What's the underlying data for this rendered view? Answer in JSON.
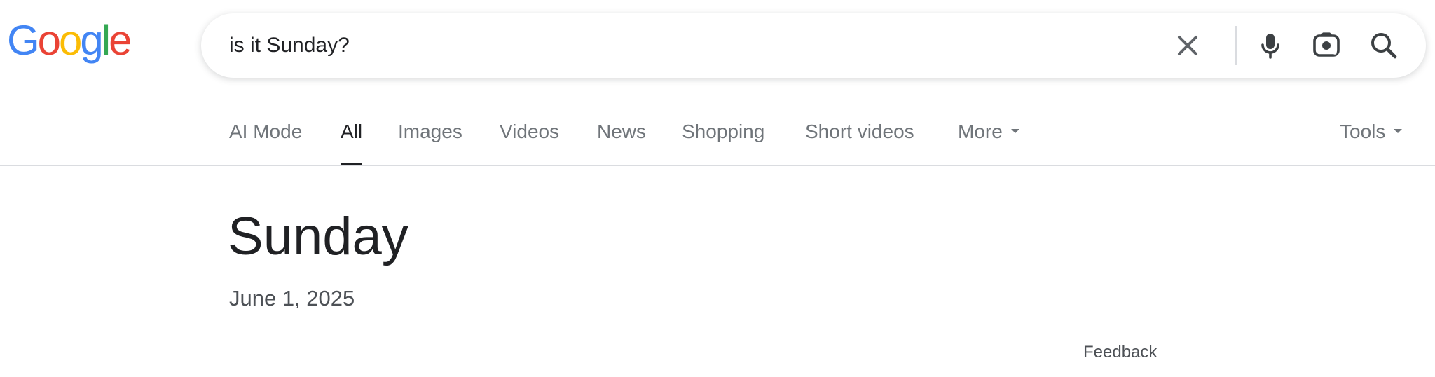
{
  "logo": {
    "letters": [
      {
        "char": "G",
        "color": "#4285F4"
      },
      {
        "char": "o",
        "color": "#EA4335"
      },
      {
        "char": "o",
        "color": "#FBBC05"
      },
      {
        "char": "g",
        "color": "#4285F4"
      },
      {
        "char": "l",
        "color": "#34A853"
      },
      {
        "char": "e",
        "color": "#EA4335"
      }
    ]
  },
  "search": {
    "value": "is it Sunday?",
    "icons": [
      "close-icon",
      "microphone-icon",
      "camera-lens-icon",
      "search-icon"
    ]
  },
  "tabs": [
    {
      "label": "AI Mode",
      "active": false
    },
    {
      "label": "All",
      "active": true
    },
    {
      "label": "Images",
      "active": false
    },
    {
      "label": "Videos",
      "active": false
    },
    {
      "label": "News",
      "active": false
    },
    {
      "label": "Shopping",
      "active": false
    },
    {
      "label": "Short videos",
      "active": false
    },
    {
      "label": "More",
      "active": false,
      "dropdown": true
    }
  ],
  "tools": {
    "label": "Tools",
    "dropdown": true
  },
  "answer": {
    "title": "Sunday",
    "date": "June 1, 2025"
  },
  "feedback_label": "Feedback",
  "colors": {
    "text_primary": "#202124",
    "text_secondary": "#70757a",
    "divider": "#dadce0",
    "icon_blue": "#1a73e8",
    "icon_gray": "#5f6368"
  }
}
